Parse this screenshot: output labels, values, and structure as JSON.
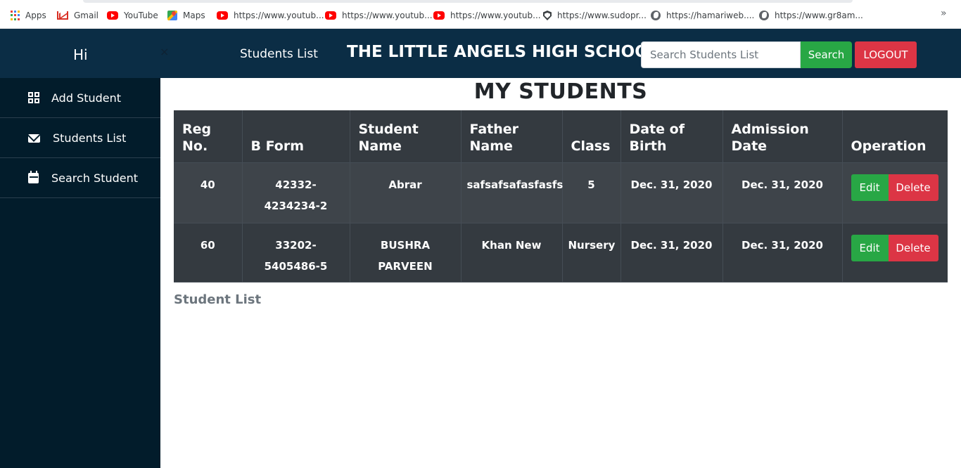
{
  "bookmarks": [
    {
      "label": "Apps",
      "icon": "apps-grid-icon"
    },
    {
      "label": "Gmail",
      "icon": "gmail-icon"
    },
    {
      "label": "YouTube",
      "icon": "youtube-icon"
    },
    {
      "label": "Maps",
      "icon": "maps-icon"
    },
    {
      "label": "https://www.youtub...",
      "icon": "youtube-icon"
    },
    {
      "label": "https://www.youtub...",
      "icon": "youtube-icon"
    },
    {
      "label": "https://www.youtub...",
      "icon": "youtube-icon"
    },
    {
      "label": "https://www.sudopr...",
      "icon": "shield-icon"
    },
    {
      "label": "https://hamariweb....",
      "icon": "globe-icon"
    },
    {
      "label": "https://www.gr8am...",
      "icon": "globe-icon"
    }
  ],
  "bookmarks_more": "»",
  "topnav": {
    "greeting": "Hi",
    "close_glyph": "×",
    "students_list_link": "Students List",
    "school_name": "THE LITTLE ANGELS HIGH SCHOOL",
    "search_placeholder": "Search Students List",
    "search_button": "Search",
    "logout_button": "LOGOUT"
  },
  "sidebar": {
    "items": [
      {
        "label": "Add Student",
        "icon": "qrcode-icon"
      },
      {
        "label": "Students List",
        "icon": "envelope-icon"
      },
      {
        "label": "Search Student",
        "icon": "calendar-icon"
      }
    ]
  },
  "main": {
    "title": "MY STUDENTS",
    "table": {
      "headers": [
        "Reg No.",
        "B Form",
        "Student Name",
        "Father Name",
        "Class",
        "Date of Birth",
        "Admission Date",
        "Operation"
      ],
      "rows": [
        {
          "reg_no": "40",
          "b_form": "42332-4234234-2",
          "student_name": "Abrar",
          "father_name": "safsafsafasfasfs",
          "class": "5",
          "dob": "Dec. 31, 2020",
          "admission_date": "Dec. 31, 2020"
        },
        {
          "reg_no": "60",
          "b_form": "33202-5405486-5",
          "student_name": "BUSHRA PARVEEN",
          "father_name": "Khan New",
          "class": "Nursery",
          "dob": "Dec. 31, 2020",
          "admission_date": "Dec. 31, 2020"
        }
      ],
      "edit_label": "Edit",
      "delete_label": "Delete"
    },
    "caption": "Student List"
  },
  "colors": {
    "navbar": "#0b2d45",
    "sidebar": "#021c2b",
    "table_dark": "#343a40",
    "success": "#28a745",
    "danger": "#dc3545"
  }
}
